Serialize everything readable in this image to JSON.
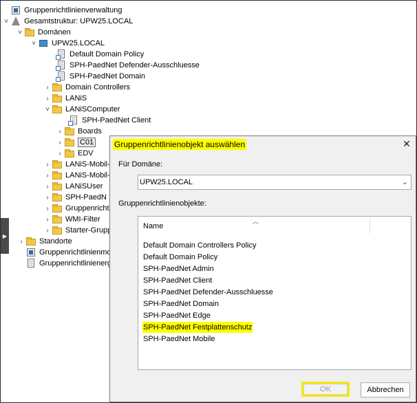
{
  "tree": {
    "items": [
      {
        "label": "Gruppenrichtlinienverwaltung",
        "icon": "gpmc-root-icon",
        "chevron": ""
      },
      {
        "label": "Gesamtstruktur: UPW25.LOCAL",
        "icon": "forest-icon",
        "chevron": "˅"
      },
      {
        "label": "Domänen",
        "icon": "domains-folder-icon",
        "chevron": "˅"
      },
      {
        "label": "UPW25.LOCAL",
        "icon": "domain-icon",
        "chevron": "˅"
      },
      {
        "label": "Default Domain Policy",
        "icon": "gpo-link-icon",
        "chevron": ""
      },
      {
        "label": "SPH-PaedNet Defender-Ausschluesse",
        "icon": "gpo-link-icon",
        "chevron": ""
      },
      {
        "label": "SPH-PaedNet Domain",
        "icon": "gpo-link-icon",
        "chevron": ""
      },
      {
        "label": "Domain Controllers",
        "icon": "ou-folder-icon",
        "chevron": "›"
      },
      {
        "label": "LANiS",
        "icon": "ou-folder-icon",
        "chevron": "›"
      },
      {
        "label": "LANiSComputer",
        "icon": "ou-folder-icon",
        "chevron": "˅"
      },
      {
        "label": "SPH-PaedNet Client",
        "icon": "gpo-link-icon",
        "chevron": ""
      },
      {
        "label": "Boards",
        "icon": "ou-folder-icon",
        "chevron": "›"
      },
      {
        "label": "C01",
        "icon": "ou-folder-icon",
        "chevron": "›"
      },
      {
        "label": "EDV",
        "icon": "ou-folder-icon",
        "chevron": "›"
      },
      {
        "label": "LANiS-Mobil-",
        "icon": "ou-folder-icon",
        "chevron": "›"
      },
      {
        "label": "LANiS-Mobil-",
        "icon": "ou-folder-icon",
        "chevron": "›"
      },
      {
        "label": "LANiSUser",
        "icon": "ou-folder-icon",
        "chevron": "›"
      },
      {
        "label": "SPH-PaedN",
        "icon": "ou-folder-icon",
        "chevron": "›"
      },
      {
        "label": "Gruppenricht",
        "icon": "folder-icon",
        "chevron": "›"
      },
      {
        "label": "WMI-Filter",
        "icon": "folder-icon",
        "chevron": "›"
      },
      {
        "label": "Starter-Grupp",
        "icon": "folder-icon",
        "chevron": "›"
      },
      {
        "label": "Standorte",
        "icon": "folder-icon",
        "chevron": "›"
      },
      {
        "label": "Gruppenrichtlinienmo",
        "icon": "modeling-icon",
        "chevron": ""
      },
      {
        "label": "Gruppenrichtlinienerg",
        "icon": "results-icon",
        "chevron": ""
      }
    ]
  },
  "dialog": {
    "title": "Gruppenrichtlinienobjekt auswählen",
    "domain_label": "Für Domäne:",
    "domain_value": "UPW25.LOCAL",
    "list_label": "Gruppenrichtlinienobjekte:",
    "column_name": "Name",
    "gpos": [
      "Default Domain Controllers Policy",
      "Default Domain Policy",
      "SPH-PaedNet Admin",
      "SPH-PaedNet Client",
      "SPH-PaedNet Defender-Ausschluesse",
      "SPH-PaedNet Domain",
      "SPH-PaedNet Edge",
      "SPH-PaedNet Festplattenschutz",
      "SPH-PaedNet Mobile"
    ],
    "highlighted_gpo": "SPH-PaedNet Festplattenschutz",
    "ok_label": "OK",
    "cancel_label": "Abbrechen",
    "highlight_color": "#ffff00"
  }
}
